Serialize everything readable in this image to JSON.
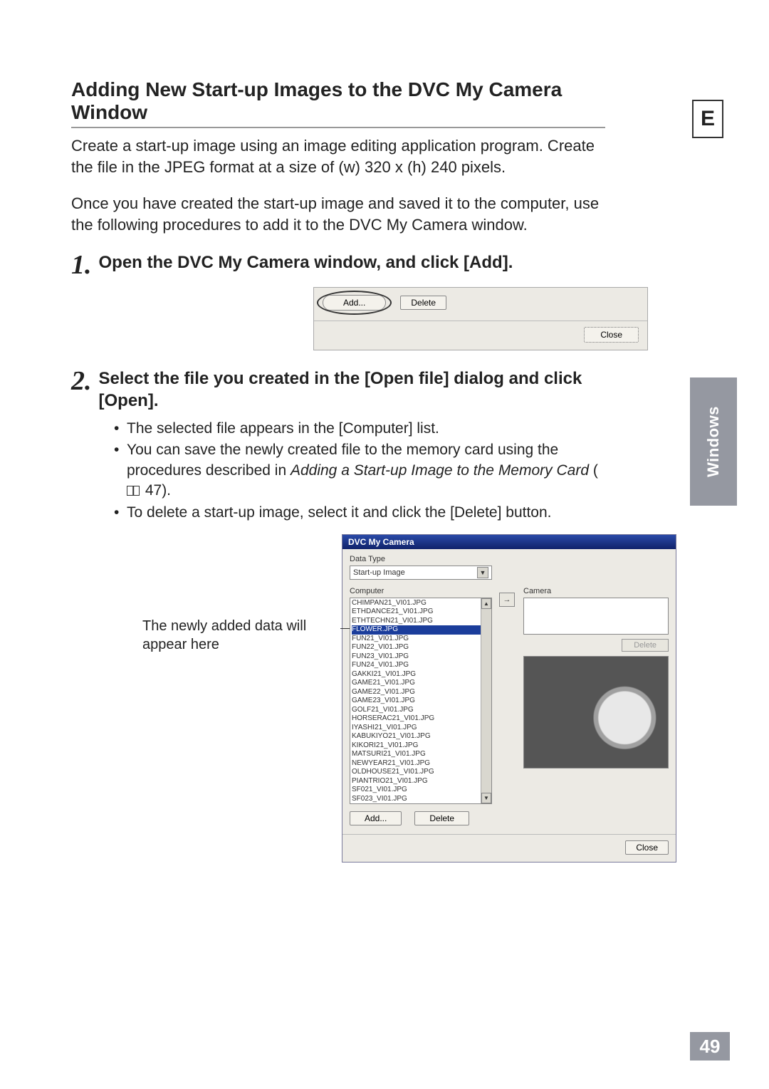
{
  "edge_letter": "E",
  "side_tab": "Windows",
  "page_number": "49",
  "section_title": "Adding New Start-up Images to the DVC My Camera Window",
  "intro_p1": "Create a start-up image using an image editing application program. Create the file in the JPEG format at a size of (w) 320 x (h) 240 pixels.",
  "intro_p2": "Once you have created the start-up image and saved it to the computer, use the following procedures to add it to the DVC My Camera window.",
  "step1": {
    "num": "1.",
    "head": "Open the DVC My Camera window, and click [Add]."
  },
  "shot1": {
    "add": "Add...",
    "delete": "Delete",
    "close": "Close"
  },
  "step2": {
    "num": "2.",
    "head": "Select the file you created in the [Open file] dialog and click [Open]."
  },
  "bullets": {
    "b1": "The selected file appears in the [Computer] list.",
    "b2a": "You can save the newly created file to the memory card using the procedures described in ",
    "b2b_italic": "Adding a Start-up Image to the Memory Card",
    "b2c": " 47).",
    "b3": "To delete a start-up image, select it and click the [Delete] button."
  },
  "callout": "The newly added data will appear here",
  "shot2": {
    "title": "DVC My Camera",
    "datatype_label": "Data Type",
    "datatype_value": "Start-up Image",
    "computer_label": "Computer",
    "camera_label": "Camera",
    "delete": "Delete",
    "add": "Add...",
    "delete2": "Delete",
    "close": "Close",
    "arrow": "→",
    "list": [
      "CHIMPAN21_VI01.JPG",
      "ETHDANCE21_VI01.JPG",
      "ETHTECHN21_VI01.JPG",
      "FLOWER.JPG",
      "FUN21_VI01.JPG",
      "FUN22_VI01.JPG",
      "FUN23_VI01.JPG",
      "FUN24_VI01.JPG",
      "GAKKI21_VI01.JPG",
      "GAME21_VI01.JPG",
      "GAME22_VI01.JPG",
      "GAME23_VI01.JPG",
      "GOLF21_VI01.JPG",
      "HORSERAC21_VI01.JPG",
      "IYASHI21_VI01.JPG",
      "KABUKIYO21_VI01.JPG",
      "KIKORI21_VI01.JPG",
      "MATSURI21_VI01.JPG",
      "NEWYEAR21_VI01.JPG",
      "OLDHOUSE21_VI01.JPG",
      "PIANTRIO21_VI01.JPG",
      "SF021_VI01.JPG",
      "SF023_VI01.JPG"
    ],
    "highlight_index": 3
  }
}
